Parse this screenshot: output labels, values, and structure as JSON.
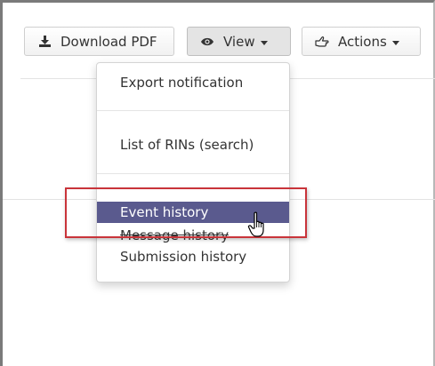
{
  "toolbar": {
    "download_label": "Download PDF",
    "download_icon": "download-icon",
    "view_label": "View",
    "view_icon": "eye-icon",
    "actions_label": "Actions",
    "actions_icon": "hand-pointer-icon"
  },
  "view_menu": {
    "items": [
      {
        "label": "Export notification"
      },
      {
        "label": "List of RINs (search)"
      },
      {
        "label": "Event history",
        "active": true
      },
      {
        "label": "Message history"
      },
      {
        "label": "Submission history"
      }
    ]
  },
  "colors": {
    "active_item_bg": "#5a5a8e",
    "highlight_border": "#c9343a"
  }
}
